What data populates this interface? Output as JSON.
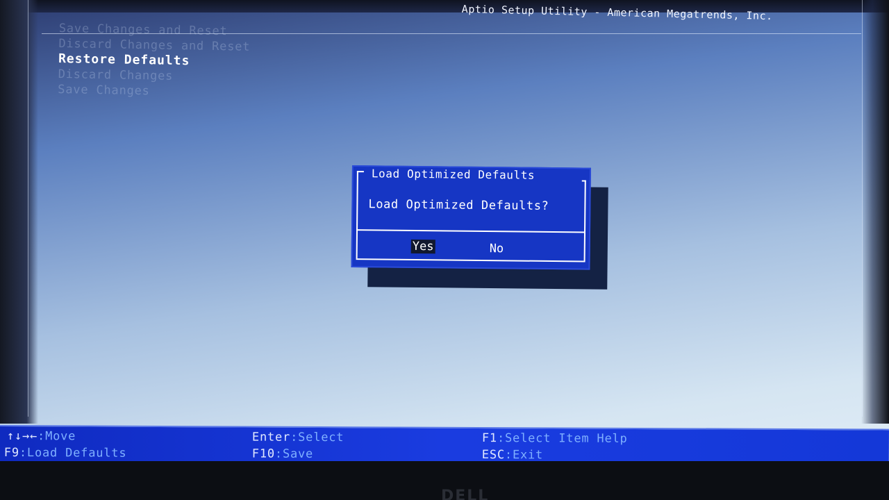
{
  "title": "Aptio Setup Utility - American Megatrends, Inc.",
  "menu": {
    "items": [
      {
        "label": "Save Changes and Reset"
      },
      {
        "label": "Discard Changes and Reset"
      },
      {
        "label": "Restore Defaults"
      },
      {
        "label": "Discard Changes"
      },
      {
        "label": "Save Changes"
      }
    ]
  },
  "dialog": {
    "title": "Load Optimized Defaults",
    "message": "Load Optimized Defaults?",
    "yes_label": "Yes",
    "no_label": "No"
  },
  "help": {
    "move_keys": "↑↓→←",
    "move": ":Move",
    "select_key": "Enter",
    "select": ":Select",
    "help_key": "F1",
    "help": ":Select Item Help",
    "load_key": "F9",
    "load": ":Load Defaults",
    "save_key": "F10",
    "save": ":Save",
    "exit_key": "ESC",
    "exit": ":Exit"
  },
  "logo": "DELL",
  "colors": {
    "dialog_bg": "#1636c4",
    "help_bar_bg": "#1a3ce0",
    "highlight": "#ffffff"
  }
}
